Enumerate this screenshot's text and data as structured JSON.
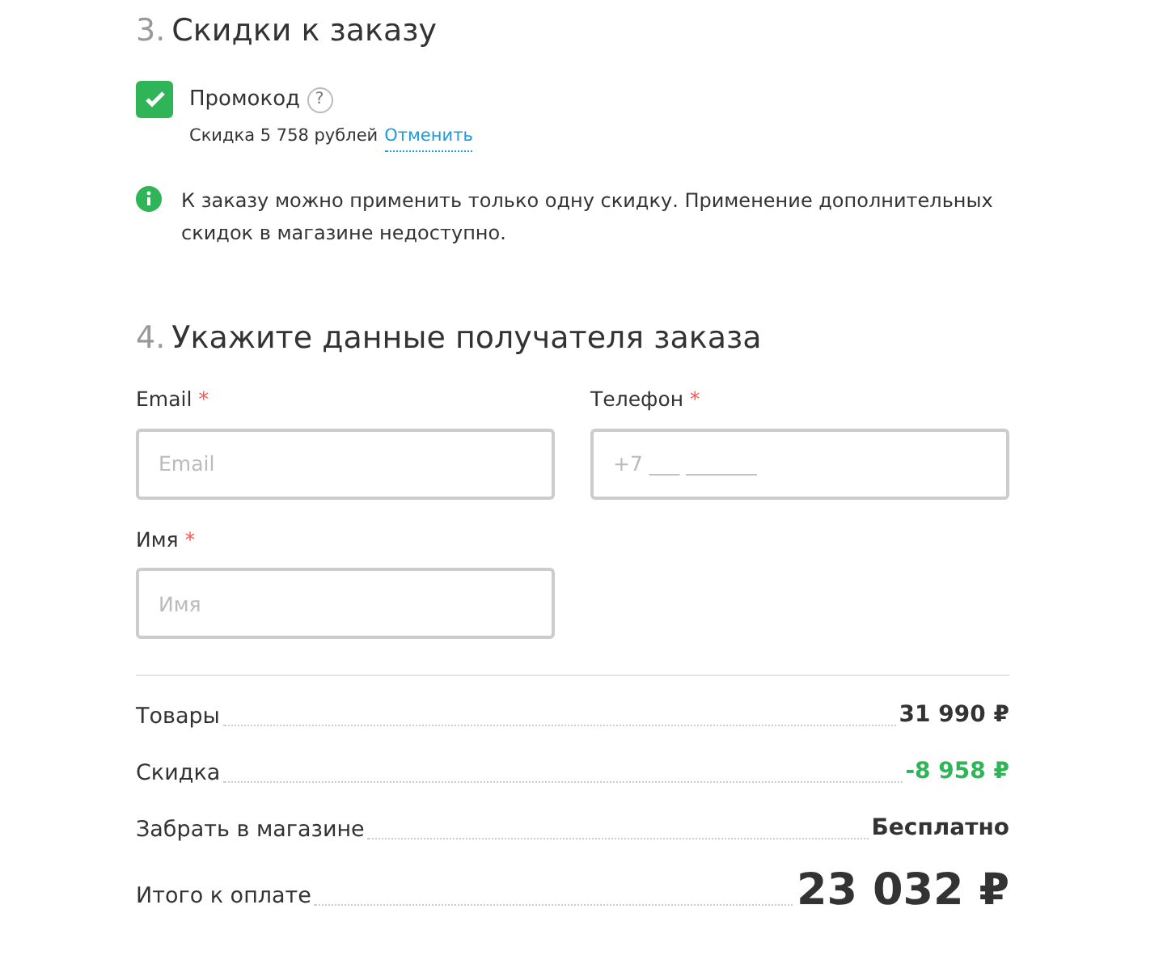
{
  "discounts": {
    "number": "3.",
    "title": "Скидки к заказу",
    "promo": {
      "label": "Промокод",
      "help": "?",
      "checked": true,
      "note": "Скидка 5 758 рублей",
      "cancel_link": "Отменить"
    },
    "info": "К заказу можно применить только одну скидку. Применение дополнительных скидок в магазине недоступно."
  },
  "recipient": {
    "number": "4.",
    "title": "Укажите данные получателя заказа",
    "fields": [
      {
        "label": "Email",
        "required_mark": "*",
        "placeholder": "Email"
      },
      {
        "label": "Телефон",
        "required_mark": "*",
        "placeholder": "+7 ___ _______"
      },
      {
        "label": "Имя",
        "required_mark": "*",
        "placeholder": "Имя"
      }
    ]
  },
  "summary": [
    {
      "kind": "normal",
      "label": "Товары",
      "value": "31 990 ₽"
    },
    {
      "kind": "discount",
      "label": "Скидка",
      "value": "-8 958 ₽"
    },
    {
      "kind": "normal",
      "label": "Забрать в магазине",
      "value": "Бесплатно"
    },
    {
      "kind": "total",
      "label": "Итого к оплате",
      "value": "23 032 ₽"
    }
  ]
}
